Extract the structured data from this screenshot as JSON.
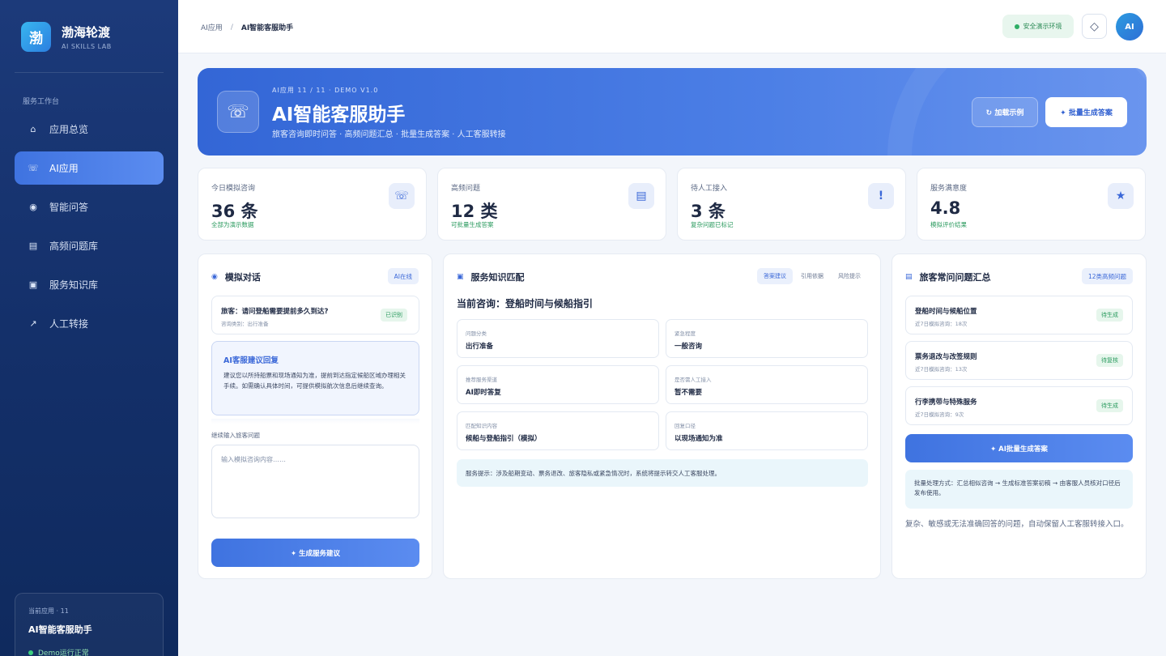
{
  "brand": {
    "logo": "渤",
    "name": "渤海轮渡",
    "sub": "AI SKILLS LAB"
  },
  "sidebar": {
    "section": "服务工作台",
    "items": [
      {
        "icon": "⌂",
        "label": "应用总览"
      },
      {
        "icon": "☏",
        "label": "AI应用"
      },
      {
        "icon": "◉",
        "label": "智能问答"
      },
      {
        "icon": "▤",
        "label": "高频问题库"
      },
      {
        "icon": "▣",
        "label": "服务知识库"
      },
      {
        "icon": "↗",
        "label": "人工转接"
      }
    ],
    "active_index": 1,
    "card": {
      "label": "当前应用 · 11",
      "title": "AI智能客服助手",
      "status": "Demo运行正常"
    }
  },
  "topbar": {
    "crumb_parent": "AI应用",
    "crumb_sep": "/",
    "crumb_current": "AI智能客服助手",
    "env_badge": "安全演示环境",
    "diamond_icon": "◇",
    "avatar": "AI"
  },
  "hero": {
    "icon": "☏",
    "kicker": "AI应用 11 / 11 · DEMO V1.0",
    "title": "AI智能客服助手",
    "desc": "旅客咨询即时问答 · 高频问题汇总 · 批量生成答案 · 人工客服转接",
    "btn_load": "↻ 加载示例",
    "btn_batch": "✦ 批量生成答案"
  },
  "stats": [
    {
      "label": "今日模拟咨询",
      "value": "36 条",
      "note": "全部为演示数据",
      "icon": "☏"
    },
    {
      "label": "高频问题",
      "value": "12 类",
      "note": "可批量生成答案",
      "icon": "▤"
    },
    {
      "label": "待人工接入",
      "value": "3 条",
      "note": "复杂问题已标记",
      "icon": "!"
    },
    {
      "label": "服务满意度",
      "value": "4.8",
      "note": "模拟评价结果",
      "icon": "★"
    }
  ],
  "chat": {
    "title": "模拟对话",
    "icon": "◉",
    "chip": "AI在线",
    "question": "旅客：请问登船需要提前多久到达?",
    "question_type": "咨询类别：出行准备",
    "question_tag": "已识别",
    "answer_title": "AI客服建议回复",
    "answer_text": "建议您以所持船票和现场通知为准，提前到达指定候船区域办理相关手续。如需确认具体时间，可提供模拟航次信息后继续查询。",
    "input_label": "继续输入旅客问题",
    "input_placeholder": "输入模拟咨询内容……",
    "generate_btn": "✦ 生成服务建议"
  },
  "knowledge": {
    "title": "服务知识匹配",
    "icon": "▣",
    "tabs": [
      "答案建议",
      "引用依据",
      "风险提示"
    ],
    "consult": "当前咨询：登船时间与候船指引",
    "fields": [
      {
        "label": "问题分类",
        "value": "出行准备"
      },
      {
        "label": "紧急程度",
        "value": "一般咨询"
      },
      {
        "label": "推荐服务渠道",
        "value": "AI即时答复"
      },
      {
        "label": "是否需人工接入",
        "value": "暂不需要"
      },
      {
        "label": "匹配知识内容",
        "value": "候船与登船指引（模拟）"
      },
      {
        "label": "回复口径",
        "value": "以现场通知为准"
      }
    ],
    "tip": "服务提示：涉及船期变动、票务退改、旅客隐私或紧急情况时，系统将提示转交人工客服处理。"
  },
  "faq": {
    "title": "旅客常问问题汇总",
    "icon": "▤",
    "chip": "12类高频问题",
    "items": [
      {
        "title": "登船时间与候船位置",
        "sub": "近7日模拟咨询：18次",
        "tag": "待生成"
      },
      {
        "title": "票务退改与改签规则",
        "sub": "近7日模拟咨询：13次",
        "tag": "待复核"
      },
      {
        "title": "行李携带与特殊服务",
        "sub": "近7日模拟咨询：9次",
        "tag": "待生成"
      }
    ],
    "batch_btn": "✦ AI批量生成答案",
    "process": "批量处理方式：汇总相似咨询 → 生成标准答案初稿 → 由客服人员核对口径后发布使用。",
    "note": "复杂、敏感或无法准确回答的问题，自动保留人工客服转接入口。"
  }
}
